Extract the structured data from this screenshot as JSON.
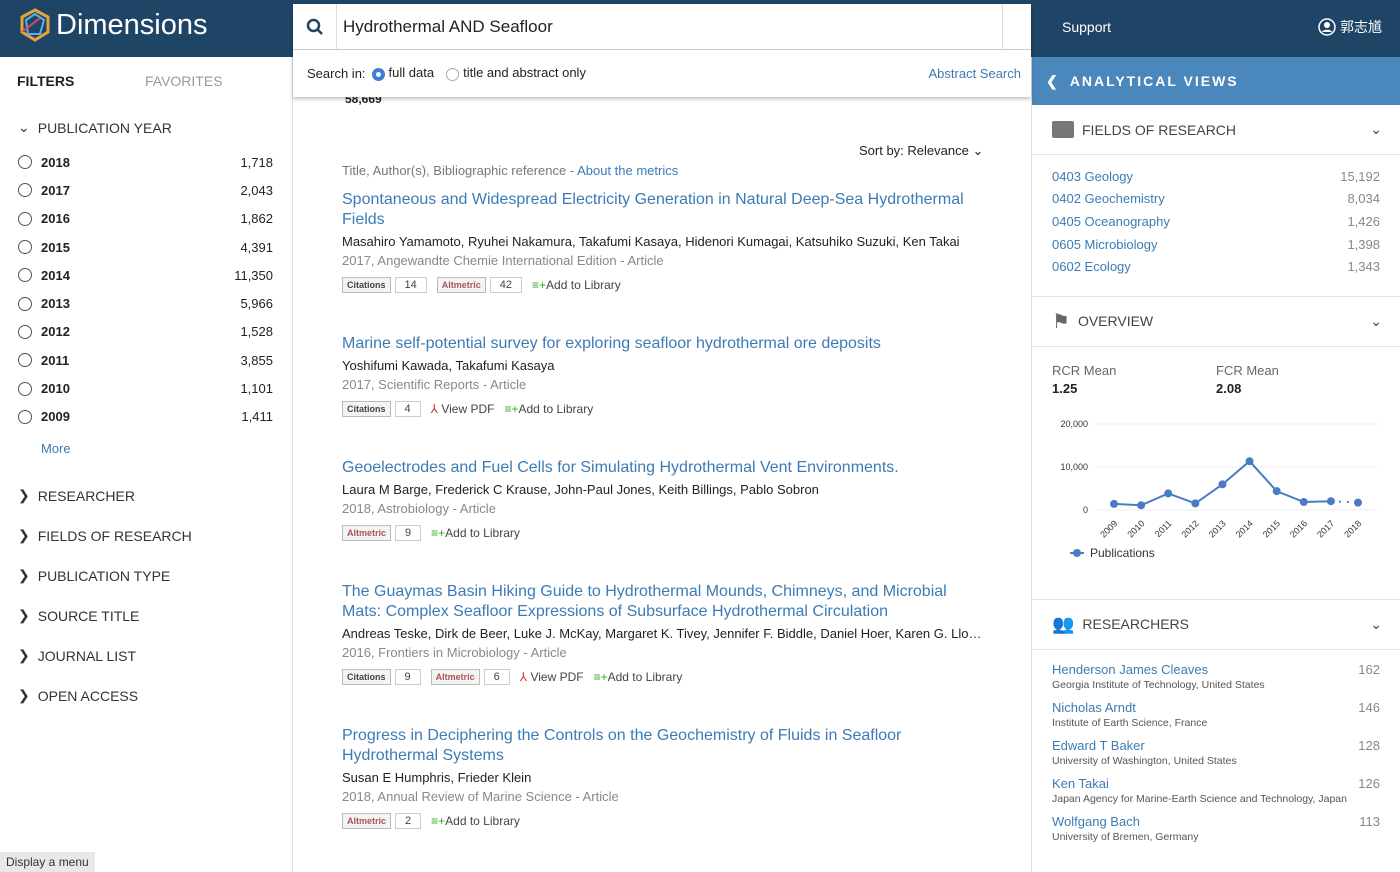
{
  "header": {
    "brand": "Dimensions",
    "support": "Support",
    "user": "郭志馗"
  },
  "search": {
    "query": "Hydrothermal AND Seafloor",
    "search_in": "Search in:",
    "opt_full": "full data",
    "opt_title": "title and abstract only",
    "abstract_search": "Abstract Search"
  },
  "sidebar": {
    "tab_filters": "FILTERS",
    "tab_favorites": "FAVORITES",
    "pub_year": "PUBLICATION YEAR",
    "years": [
      {
        "y": "2018",
        "c": "1,718"
      },
      {
        "y": "2017",
        "c": "2,043"
      },
      {
        "y": "2016",
        "c": "1,862"
      },
      {
        "y": "2015",
        "c": "4,391"
      },
      {
        "y": "2014",
        "c": "11,350"
      },
      {
        "y": "2013",
        "c": "5,966"
      },
      {
        "y": "2012",
        "c": "1,528"
      },
      {
        "y": "2011",
        "c": "3,855"
      },
      {
        "y": "2010",
        "c": "1,101"
      },
      {
        "y": "2009",
        "c": "1,411"
      }
    ],
    "more": "More",
    "sections": [
      "RESEARCHER",
      "FIELDS OF RESEARCH",
      "PUBLICATION TYPE",
      "SOURCE TITLE",
      "JOURNAL LIST",
      "OPEN ACCESS"
    ]
  },
  "main": {
    "total": "58,669",
    "sort_label": "Sort by:",
    "sort_value": "Relevance",
    "metrics_text": "Title, Author(s), Bibliographic reference - ",
    "metrics_link": "About the metrics",
    "results": [
      {
        "title": "Spontaneous and Widespread Electricity Generation in Natural Deep-Sea Hydrothermal Fields",
        "authors": "Masahiro Yamamoto, Ryuhei Nakamura, Takafumi Kasaya, Hidenori Kumagai, Katsuhiko Suzuki, Ken Takai",
        "source": "2017, Angewandte Chemie International Edition - Article",
        "citations": "14",
        "altmetric": "42",
        "pdf": "",
        "library": "Add to Library"
      },
      {
        "title": "Marine self-potential survey for exploring seafloor hydrothermal ore deposits",
        "authors": "Yoshifumi Kawada, Takafumi Kasaya",
        "source": "2017, Scientific Reports - Article",
        "citations": "4",
        "altmetric": "",
        "pdf": "View PDF",
        "library": "Add to Library"
      },
      {
        "title": "Geoelectrodes and Fuel Cells for Simulating Hydrothermal Vent Environments.",
        "authors": "Laura M Barge, Frederick C Krause, John-Paul Jones, Keith Billings, Pablo Sobron",
        "source": "2018, Astrobiology - Article",
        "citations": "",
        "altmetric": "9",
        "pdf": "",
        "library": "Add to Library"
      },
      {
        "title": "The Guaymas Basin Hiking Guide to Hydrothermal Mounds, Chimneys, and Microbial Mats: Complex Seafloor Expressions of Subsurface Hydrothermal Circulation",
        "authors": "Andreas Teske, Dirk de Beer, Luke J. McKay, Margaret K. Tivey, Jennifer F. Biddle, Daniel Hoer, Karen G. Lloyd, Ma...",
        "source": "2016, Frontiers in Microbiology - Article",
        "citations": "9",
        "altmetric": "6",
        "pdf": "View PDF",
        "library": "Add to Library"
      },
      {
        "title": "Progress in Deciphering the Controls on the Geochemistry of Fluids in Seafloor Hydrothermal Systems",
        "authors": "Susan E Humphris, Frieder Klein",
        "source": "2018, Annual Review of Marine Science - Article",
        "citations": "",
        "altmetric": "2",
        "pdf": "",
        "library": "Add to Library"
      }
    ],
    "badge_citations": "Citations",
    "badge_altmetric": "Altmetric"
  },
  "right": {
    "title": "ANALYTICAL VIEWS",
    "fields_title": "FIELDS OF RESEARCH",
    "fields": [
      {
        "n": "0403 Geology",
        "c": "15,192"
      },
      {
        "n": "0402 Geochemistry",
        "c": "8,034"
      },
      {
        "n": "0405 Oceanography",
        "c": "1,426"
      },
      {
        "n": "0605 Microbiology",
        "c": "1,398"
      },
      {
        "n": "0602 Ecology",
        "c": "1,343"
      }
    ],
    "overview_title": "OVERVIEW",
    "rcr_label": "RCR Mean",
    "rcr": "1.25",
    "fcr_label": "FCR Mean",
    "fcr": "2.08",
    "researchers_title": "RESEARCHERS",
    "researchers": [
      {
        "n": "Henderson James Cleaves",
        "c": "162",
        "i": "Georgia Institute of Technology, United States"
      },
      {
        "n": "Nicholas Arndt",
        "c": "146",
        "i": "Institute of Earth Science, France"
      },
      {
        "n": "Edward T Baker",
        "c": "128",
        "i": "University of Washington, United States"
      },
      {
        "n": "Ken Takai",
        "c": "126",
        "i": "Japan Agency for Marine-Earth Science and Technology, Japan"
      },
      {
        "n": "Wolfgang Bach",
        "c": "113",
        "i": "University of Bremen, Germany"
      }
    ]
  },
  "chart_data": {
    "type": "line",
    "categories": [
      "2009",
      "2010",
      "2011",
      "2012",
      "2013",
      "2014",
      "2015",
      "2016",
      "2017",
      "2018"
    ],
    "series": [
      {
        "name": "Publications",
        "values": [
          1411,
          1101,
          3855,
          1528,
          5966,
          11350,
          4391,
          1862,
          2043,
          1718
        ]
      }
    ],
    "yticks": [
      "0",
      "10,000",
      "20,000"
    ],
    "ylim": [
      0,
      20000
    ],
    "legend": "bottom-left",
    "color": "#4a7cc4",
    "grid": true
  },
  "status": "Display a menu"
}
